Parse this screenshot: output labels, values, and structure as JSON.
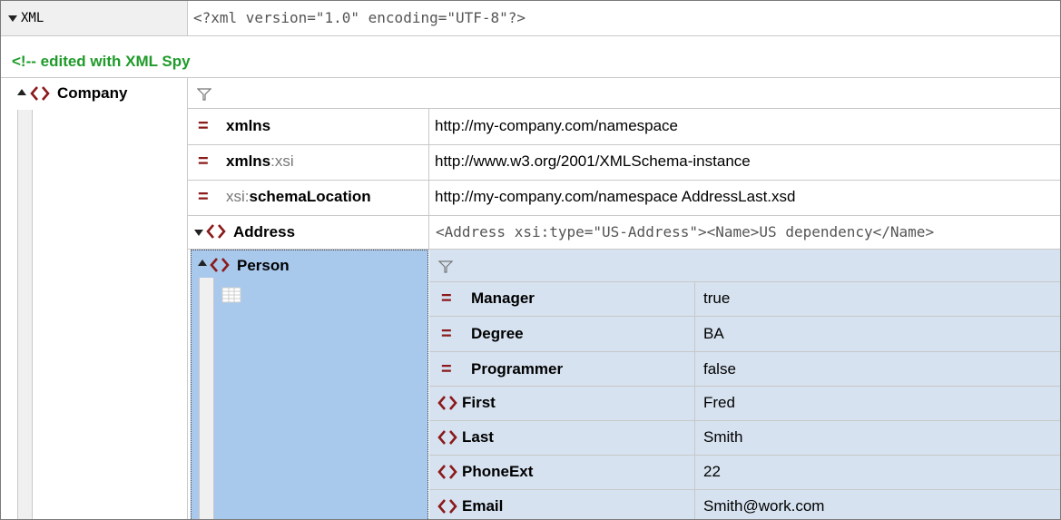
{
  "xml_row": {
    "label": "XML",
    "declaration": "<?xml version=\"1.0\" encoding=\"UTF-8\"?>"
  },
  "comment": "<!-- edited with XML Spy",
  "company": {
    "name": "Company",
    "attributes": [
      {
        "prefix": "",
        "name": "xmlns",
        "suffix": "",
        "value": "http://my-company.com/namespace"
      },
      {
        "prefix": "",
        "name": "xmlns",
        "suffix": ":xsi",
        "value": "http://www.w3.org/2001/XMLSchema-instance"
      },
      {
        "prefix": "xsi:",
        "name": "schemaLocation",
        "suffix": "",
        "value": "http://my-company.com/namespace AddressLast.xsd"
      }
    ],
    "address": {
      "name": "Address",
      "preview": "<Address xsi:type=\"US-Address\"><Name>US dependency</Name>"
    },
    "person": {
      "name": "Person",
      "attributes": [
        {
          "name": "Manager",
          "value": "true"
        },
        {
          "name": "Degree",
          "value": "BA"
        },
        {
          "name": "Programmer",
          "value": "false"
        }
      ],
      "elements": [
        {
          "name": "First",
          "value": "Fred"
        },
        {
          "name": "Last",
          "value": "Smith"
        },
        {
          "name": "PhoneExt",
          "value": "22"
        },
        {
          "name": "Email",
          "value": "Smith@work.com"
        }
      ]
    }
  },
  "colors": {
    "tag_icon": "#8b1a1a",
    "comment": "#1f9b2a",
    "selected": "#a8c8ec",
    "person_bg": "#d6e2f0"
  }
}
